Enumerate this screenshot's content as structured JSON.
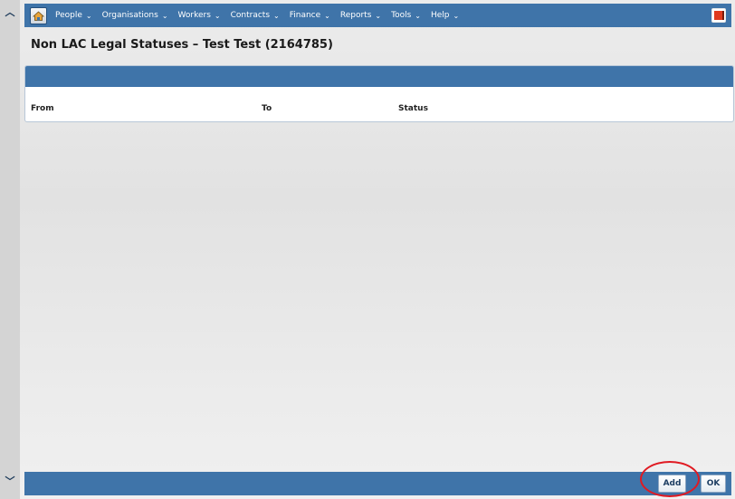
{
  "menubar": {
    "items": [
      {
        "label": "People"
      },
      {
        "label": "Organisations"
      },
      {
        "label": "Workers"
      },
      {
        "label": "Contracts"
      },
      {
        "label": "Finance"
      },
      {
        "label": "Reports"
      },
      {
        "label": "Tools"
      },
      {
        "label": "Help"
      }
    ],
    "chevron": "⌄"
  },
  "page": {
    "title": "Non LAC Legal Statuses – Test Test (2164785)"
  },
  "table": {
    "columns": [
      "From",
      "To",
      "Status"
    ],
    "rows": []
  },
  "buttons": {
    "add_label": "Add",
    "ok_label": "OK"
  },
  "colors": {
    "bar": "#3f74a9",
    "highlight": "#e01a22",
    "logout": "#e03a1e"
  },
  "icons": {
    "home": "home-icon",
    "logout": "logout-icon",
    "scroll_up": "chevron-up-icon",
    "scroll_down": "chevron-down-icon"
  }
}
